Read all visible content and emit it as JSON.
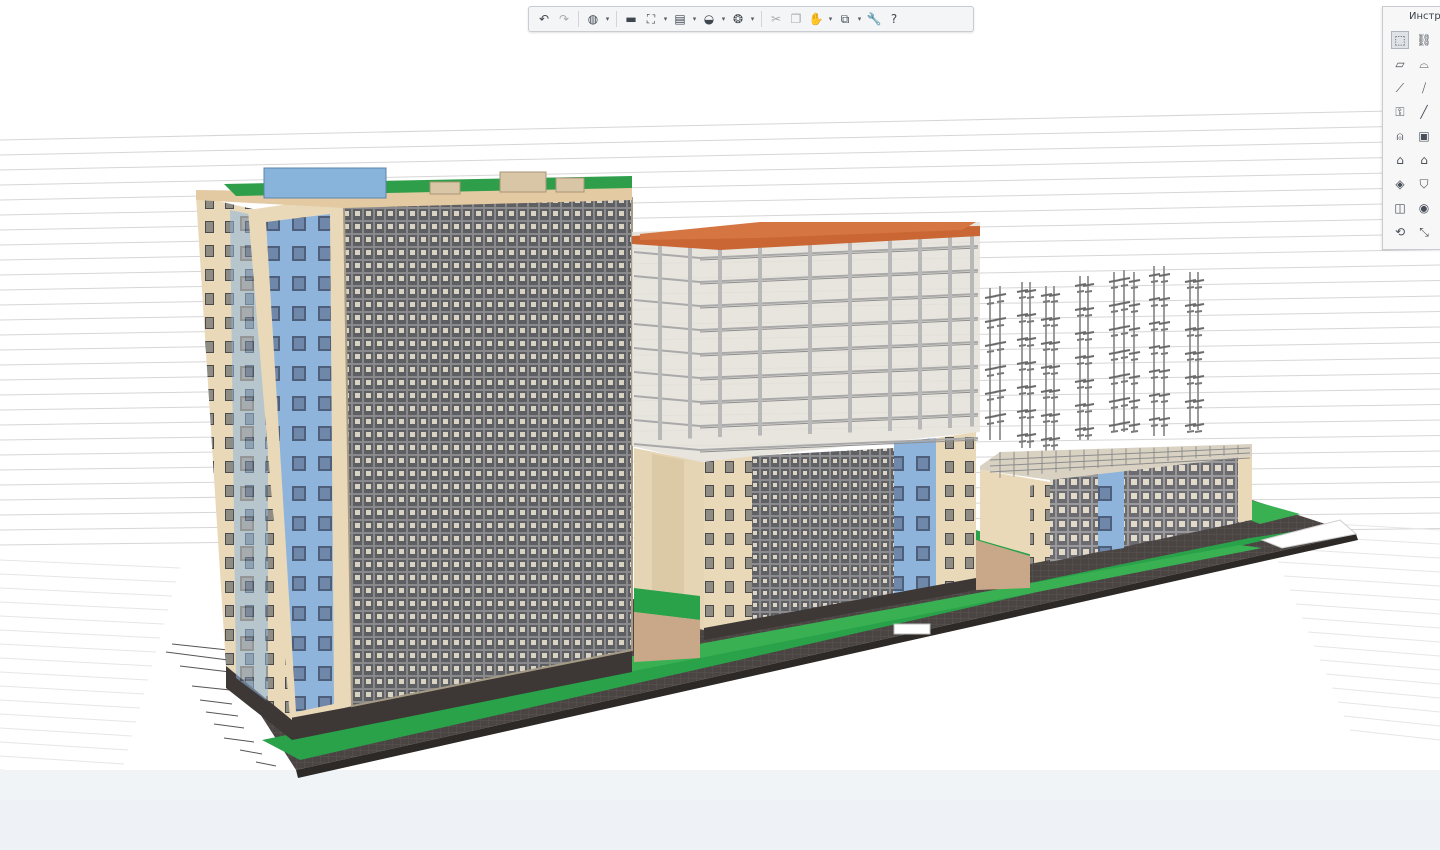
{
  "window": {
    "panel_title": "Инстру"
  },
  "toolbar": {
    "items": [
      {
        "name": "undo-button",
        "icon": "undo-icon",
        "glyph": "↶"
      },
      {
        "name": "redo-button",
        "icon": "redo-icon",
        "glyph": "↷",
        "dim": true
      },
      {
        "sep": true
      },
      {
        "name": "view-3d-button",
        "icon": "globe-view-icon",
        "glyph": "◍"
      },
      {
        "name": "view-3d-dropdown",
        "drop": true
      },
      {
        "sep": true
      },
      {
        "name": "section-box-button",
        "icon": "box-section-icon",
        "glyph": "▬"
      },
      {
        "name": "frame-button",
        "icon": "frame-icon",
        "glyph": "⛶"
      },
      {
        "name": "frame-dropdown",
        "drop": true
      },
      {
        "name": "layers-button",
        "icon": "layers-icon",
        "glyph": "▤"
      },
      {
        "name": "layers-dropdown",
        "drop": true
      },
      {
        "name": "visibility-button",
        "icon": "eye-icon",
        "glyph": "◒"
      },
      {
        "name": "visibility-dropdown",
        "drop": true
      },
      {
        "name": "render-style-button",
        "icon": "render-style-icon",
        "glyph": "❂"
      },
      {
        "name": "render-style-dropdown",
        "drop": true
      },
      {
        "sep": true
      },
      {
        "name": "cut-button",
        "icon": "scissors-icon",
        "glyph": "✂",
        "dim": true
      },
      {
        "name": "copy-button",
        "icon": "copy-icon",
        "glyph": "❐",
        "dim": true
      },
      {
        "name": "pan-button",
        "icon": "hand-icon",
        "glyph": "✋"
      },
      {
        "name": "pan-dropdown",
        "drop": true
      },
      {
        "name": "cube-button",
        "icon": "cube-icon",
        "glyph": "⧉"
      },
      {
        "name": "cube-dropdown",
        "drop": true
      },
      {
        "name": "settings-button",
        "icon": "wrench-icon",
        "glyph": "🔧"
      },
      {
        "name": "help-button",
        "icon": "help-icon",
        "glyph": "?"
      }
    ]
  },
  "tool_panel": {
    "items": [
      {
        "name": "select-tool",
        "icon": "pointer-icon",
        "glyph": "⬚",
        "active": true,
        "col": 0,
        "row": 0
      },
      {
        "name": "link-tool",
        "icon": "link-icon",
        "glyph": "⛓",
        "col": 1,
        "row": 0
      },
      {
        "name": "slab-tool",
        "icon": "slab-icon",
        "glyph": "▱",
        "col": 0,
        "row": 1
      },
      {
        "name": "roof-tool",
        "icon": "roof-icon",
        "glyph": "⌓",
        "col": 1,
        "row": 1
      },
      {
        "name": "beam-tool",
        "icon": "beam-icon",
        "glyph": "⟋",
        "col": 0,
        "row": 2
      },
      {
        "name": "column-tool",
        "icon": "column-icon",
        "glyph": "⧸",
        "col": 1,
        "row": 2
      },
      {
        "name": "stair-tool",
        "icon": "stair-icon",
        "glyph": "⚿",
        "col": 0,
        "row": 3
      },
      {
        "name": "line-tool",
        "icon": "line-icon",
        "glyph": "╱",
        "col": 1,
        "row": 3
      },
      {
        "name": "door-tool",
        "icon": "door-icon",
        "glyph": "⍝",
        "col": 0,
        "row": 4
      },
      {
        "name": "window-tool",
        "icon": "window-icon",
        "glyph": "▣",
        "col": 1,
        "row": 4
      },
      {
        "name": "zone-tool",
        "icon": "zone-icon",
        "glyph": "⌂",
        "col": 0,
        "row": 5
      },
      {
        "name": "house-tool",
        "icon": "house-icon",
        "glyph": "⌂",
        "col": 1,
        "row": 5
      },
      {
        "name": "object-tool",
        "icon": "object-icon",
        "glyph": "◈",
        "col": 0,
        "row": 6
      },
      {
        "name": "shield-tool",
        "icon": "shield-icon",
        "glyph": "⛉",
        "col": 1,
        "row": 6
      },
      {
        "name": "opening-tool",
        "icon": "opening-icon",
        "glyph": "◫",
        "col": 0,
        "row": 7
      },
      {
        "name": "lamp-tool",
        "icon": "lamp-icon",
        "glyph": "◉",
        "col": 1,
        "row": 7
      },
      {
        "name": "dimension-tool",
        "icon": "dimension-icon",
        "glyph": "⟲",
        "col": 0,
        "row": 8
      },
      {
        "name": "measure-tool",
        "icon": "measure-icon",
        "glyph": "⤡",
        "col": 1,
        "row": 8
      }
    ]
  },
  "colors": {
    "facade_beige": "#ead9b9",
    "facade_blue": "#8eb4dc",
    "curtain_grid": "#6b6b6e",
    "roof_orange": "#c96633",
    "ground_green": "#2aa24a",
    "base_dark": "#3d3836",
    "structure_gray": "#c9c9c9"
  }
}
